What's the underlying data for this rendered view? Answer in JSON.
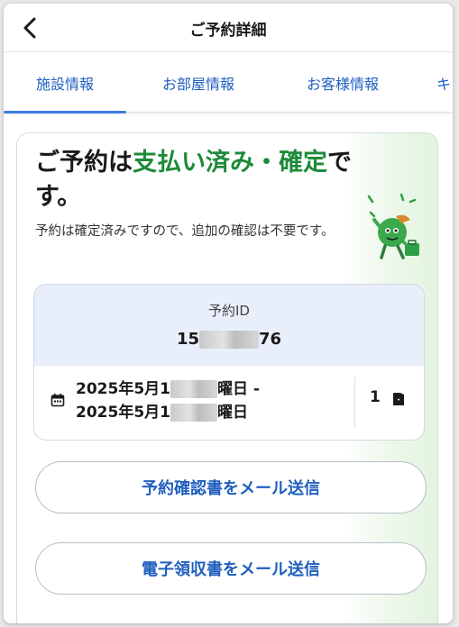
{
  "header": {
    "title": "ご予約詳細",
    "back_icon": "chevron-left-icon"
  },
  "tabs": [
    {
      "label": "施設情報",
      "active": true
    },
    {
      "label": "お部屋情報",
      "active": false
    },
    {
      "label": "お客様情報",
      "active": false
    },
    {
      "label": "キ",
      "active": false
    }
  ],
  "status": {
    "headline_prefix": "ご予約は",
    "headline_highlight": "支払い済み・確定",
    "headline_suffix": "です。",
    "description": "予約は確定済みですので、追加の確認は不要です。",
    "mascot_icon": "mascot-illustration"
  },
  "booking": {
    "id_label": "予約ID",
    "id_prefix": "15",
    "id_suffix": "76",
    "checkin_prefix": "2025年5月1",
    "checkin_suffix": "曜日 -",
    "checkout_prefix": "2025年5月1",
    "checkout_suffix": "曜日",
    "guest_count": "1",
    "calendar_icon": "calendar-icon",
    "room_icon": "door-icon"
  },
  "actions": {
    "email_confirmation": "予約確認書をメール送信",
    "email_receipt": "電子領収書をメール送信"
  },
  "colors": {
    "accent_blue": "#1f5fbf",
    "tab_indicator": "#3b7de0",
    "status_green": "#1e8a3a",
    "booking_header_bg": "#e8eefa"
  }
}
